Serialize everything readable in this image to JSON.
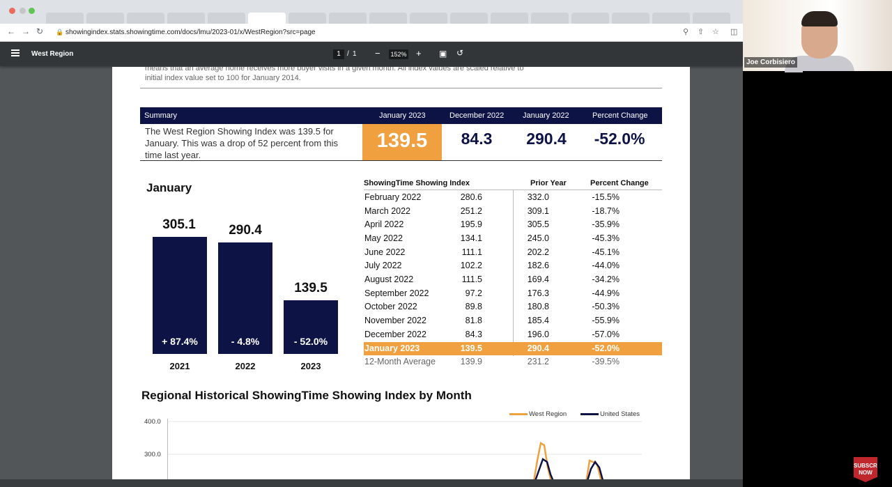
{
  "browser": {
    "url": "showingindex.stats.showingtime.com/docs/lmu/2023-01/x/WestRegion?src=page"
  },
  "pdf_toolbar": {
    "title": "West Region",
    "page_current": "1",
    "page_sep": "/",
    "page_total": "1",
    "zoom": "152%",
    "minus": "−",
    "plus": "+"
  },
  "document": {
    "intro_text": "means that an average home receives more buyer visits in a given month. All index values are scaled relative to initial index value set to 100 for January 2014.",
    "summary": {
      "header": "Summary",
      "col1": "January 2023",
      "col2": "December 2022",
      "col3": "January 2022",
      "col4": "Percent Change",
      "text": "The West Region Showing Index was 139.5 for January. This was a drop of 52 percent from this time last year.",
      "val1": "139.5",
      "val2": "84.3",
      "val3": "290.4",
      "val4": "-52.0%"
    },
    "january_chart": {
      "title": "January",
      "bars": [
        {
          "year": "2021",
          "value": "305.1",
          "change": "+ 87.4%"
        },
        {
          "year": "2022",
          "value": "290.4",
          "change": "- 4.8%"
        },
        {
          "year": "2023",
          "value": "139.5",
          "change": "- 52.0%"
        }
      ]
    },
    "table": {
      "header_index": "ShowingTime Showing Index",
      "header_prior": "Prior Year",
      "header_pct": "Percent Change",
      "rows": [
        {
          "month": "February 2022",
          "value": "280.6",
          "prior": "332.0",
          "pct": "-15.5%"
        },
        {
          "month": "March 2022",
          "value": "251.2",
          "prior": "309.1",
          "pct": "-18.7%"
        },
        {
          "month": "April 2022",
          "value": "195.9",
          "prior": "305.5",
          "pct": "-35.9%"
        },
        {
          "month": "May 2022",
          "value": "134.1",
          "prior": "245.0",
          "pct": "-45.3%"
        },
        {
          "month": "June 2022",
          "value": "111.1",
          "prior": "202.2",
          "pct": "-45.1%"
        },
        {
          "month": "July 2022",
          "value": "102.2",
          "prior": "182.6",
          "pct": "-44.0%"
        },
        {
          "month": "August 2022",
          "value": "111.5",
          "prior": "169.4",
          "pct": "-34.2%"
        },
        {
          "month": "September 2022",
          "value": "97.2",
          "prior": "176.3",
          "pct": "-44.9%"
        },
        {
          "month": "October 2022",
          "value": "89.8",
          "prior": "180.8",
          "pct": "-50.3%"
        },
        {
          "month": "November 2022",
          "value": "81.8",
          "prior": "185.4",
          "pct": "-55.9%"
        },
        {
          "month": "December 2022",
          "value": "84.3",
          "prior": "196.0",
          "pct": "-57.0%"
        },
        {
          "month": "January 2023",
          "value": "139.5",
          "prior": "290.4",
          "pct": "-52.0%"
        },
        {
          "month": "12-Month Average",
          "value": "139.9",
          "prior": "231.2",
          "pct": "-39.5%"
        }
      ]
    },
    "historical": {
      "title": "Regional Historical ShowingTime Showing Index by Month",
      "legend_west": "West Region",
      "legend_us": "United States",
      "y400": "400.0",
      "y300": "300.0"
    }
  },
  "presenter": {
    "name": "Joe Corbisiero"
  },
  "subscribe": {
    "label": "SUBSCRIBE NOW"
  },
  "colors": {
    "navy": "#0e1346",
    "orange": "#f0a03e"
  }
}
